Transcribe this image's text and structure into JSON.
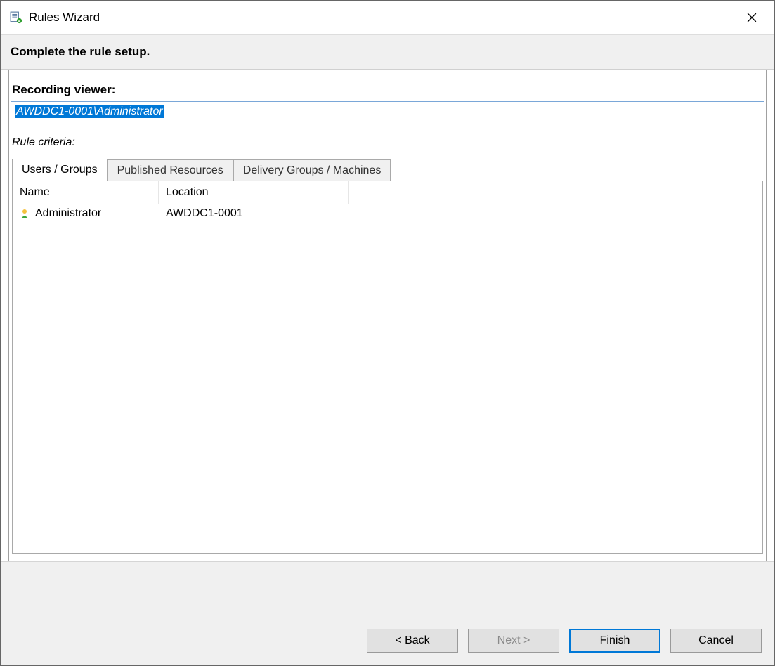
{
  "window": {
    "title": "Rules Wizard"
  },
  "header": {
    "text": "Complete the rule setup."
  },
  "recording_viewer": {
    "label": "Recording viewer:",
    "value": "AWDDC1-0001\\Administrator"
  },
  "rule_criteria": {
    "label": "Rule criteria:"
  },
  "tabs": {
    "users_groups": "Users / Groups",
    "published_resources": "Published Resources",
    "delivery_groups": "Delivery Groups / Machines"
  },
  "columns": {
    "name": "Name",
    "location": "Location"
  },
  "rows": [
    {
      "name": "Administrator",
      "location": "AWDDC1-0001"
    }
  ],
  "buttons": {
    "back": "< Back",
    "next": "Next >",
    "finish": "Finish",
    "cancel": "Cancel"
  }
}
